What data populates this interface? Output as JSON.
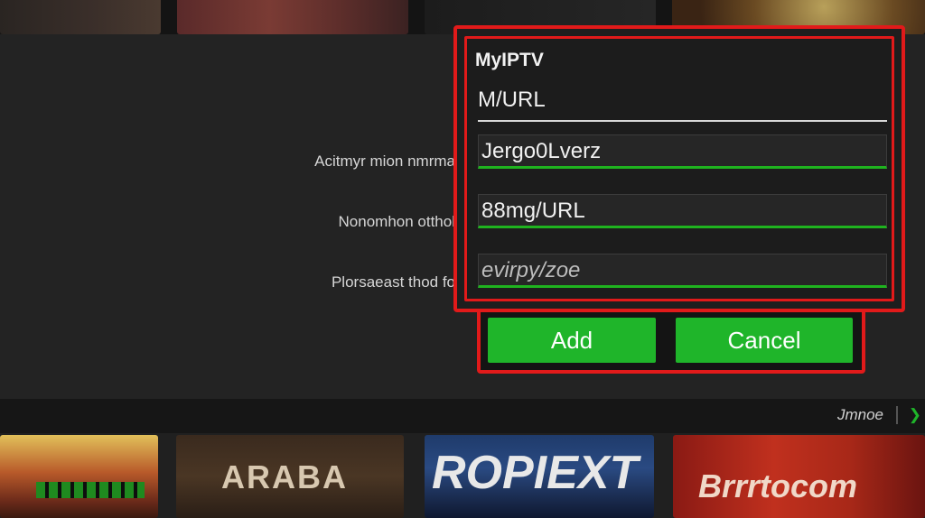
{
  "dialog": {
    "title": "MyIPTV",
    "url_label": "M/URL",
    "fields": [
      {
        "value": "Jergo0Lverz"
      },
      {
        "value": "88mg/URL"
      },
      {
        "value": "evirpy/zoe"
      }
    ]
  },
  "side_labels": [
    "Acitmyr mion nmrma",
    "Nonomhon otthol",
    "Plorsaeast thod fo"
  ],
  "buttons": {
    "add_label": "Add",
    "cancel_label": "Cancel"
  },
  "bottom": {
    "more_label": "Jmnoe",
    "more_icon": "green-arrow-icon",
    "posters": [
      {
        "title": ""
      },
      {
        "title": "ARABA"
      },
      {
        "title": "ROPIEXT"
      },
      {
        "title": "Brrrtocom"
      }
    ]
  },
  "colors": {
    "accent_red": "#e11a1a",
    "accent_green": "#1fb52a",
    "background": "#232323"
  }
}
